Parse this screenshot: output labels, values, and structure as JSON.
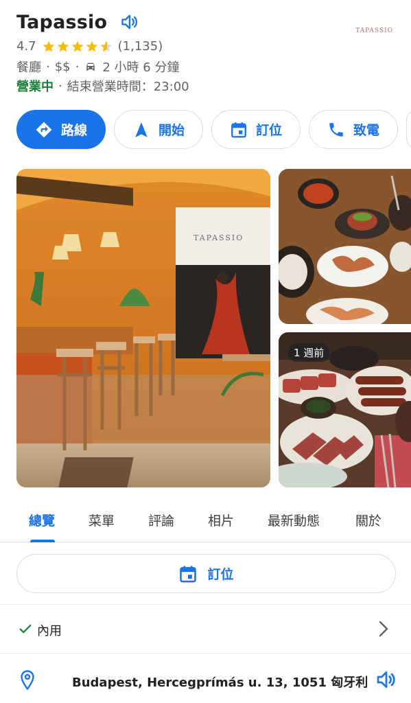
{
  "place": {
    "name": "Tapassio",
    "logo_text": "TAPASSIO",
    "rating": "4.7",
    "review_count": "(1,135)",
    "stars_filled": 4.5,
    "category": "餐廳",
    "price": "$$",
    "travel_time": "2 小時 6 分鐘",
    "open_status": "營業中",
    "closing_info": "結束營業時間：23:00"
  },
  "actions": {
    "directions": "路線",
    "start": "開始",
    "reserve": "訂位",
    "call": "致電"
  },
  "photos": {
    "side_badge": "1 週前",
    "main_sign": "TAPASSIO"
  },
  "tabs": [
    "總覽",
    "菜單",
    "評論",
    "相片",
    "最新動態",
    "關於"
  ],
  "reserve_button": "訂位",
  "dine_in": {
    "label": "內用"
  },
  "address": {
    "text": "Budapest, Hercegprímás u. 13, 1051 匈牙利"
  },
  "colors": {
    "accent": "#1a73e8",
    "open_green": "#188038",
    "star": "#fbbc04"
  },
  "icons": {
    "title_speaker": "volume-icon",
    "car": "car-icon",
    "directions": "directions-icon",
    "start": "navigation-arrow-icon",
    "reserve": "calendar-icon",
    "call": "phone-icon",
    "check": "check-icon",
    "chevron": "chevron-right-icon",
    "pin": "location-pin-icon",
    "address_speaker": "volume-icon"
  }
}
